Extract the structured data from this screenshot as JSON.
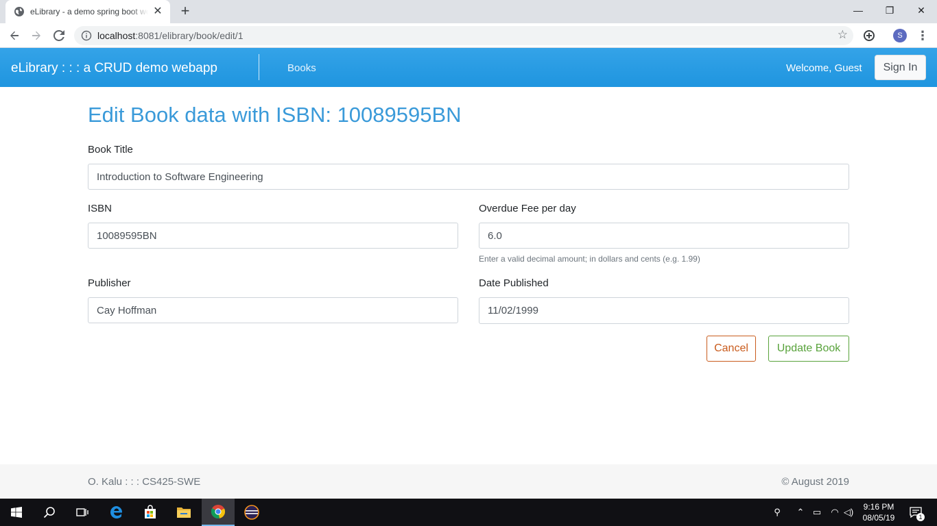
{
  "browser": {
    "tab_title": "eLibrary - a demo spring boot webapp",
    "tab_close_glyph": "✕",
    "new_tab_glyph": "+",
    "url_host": "localhost",
    "url_path": ":8081/elibrary/book/edit/1",
    "profile_initial": "S",
    "window_controls": {
      "minimize": "—",
      "restore": "❐",
      "close": "✕"
    }
  },
  "navbar": {
    "brand": "eLibrary : : : a CRUD demo webapp",
    "books_link": "Books",
    "welcome": "Welcome, Guest",
    "signin_label": "Sign In",
    "accent_color": "#2a9de4"
  },
  "form": {
    "heading": "Edit Book data with ISBN: 10089595BN",
    "title_label": "Book Title",
    "title_value": "Introduction to Software Engineering",
    "isbn_label": "ISBN",
    "isbn_value": "10089595BN",
    "fee_label": "Overdue Fee per day",
    "fee_value": "6.0",
    "fee_hint": "Enter a valid decimal amount; in dollars and cents (e.g. 1.99)",
    "publisher_label": "Publisher",
    "publisher_value": "Cay Hoffman",
    "date_label": "Date Published",
    "date_value": "11/02/1999",
    "cancel_label": "Cancel",
    "update_label": "Update Book"
  },
  "footer": {
    "left": "O. Kalu : : : CS425-SWE",
    "right": "© August 2019"
  },
  "taskbar": {
    "time": "9:16 PM",
    "date": "08/05/19",
    "notification_count": "1",
    "icons": [
      "windows-start-icon",
      "search-icon",
      "task-view-icon",
      "edge-icon",
      "store-icon",
      "file-explorer-icon",
      "chrome-icon",
      "eclipse-icon"
    ]
  }
}
